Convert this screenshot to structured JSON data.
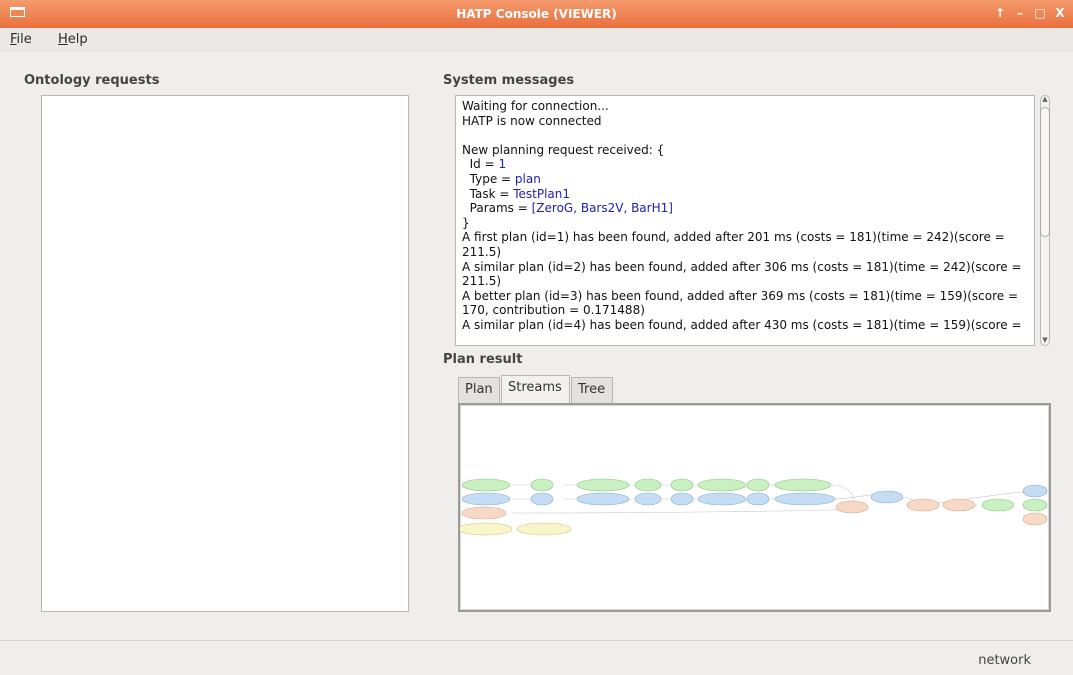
{
  "window": {
    "title": "HATP Console (VIEWER)",
    "controls": [
      "↑",
      "–",
      "□",
      "X"
    ]
  },
  "menu": {
    "file": {
      "mnemonic": "F",
      "rest": "ile"
    },
    "help": {
      "mnemonic": "H",
      "rest": "elp"
    }
  },
  "ontology": {
    "title": "Ontology requests"
  },
  "system_messages": {
    "title": "System messages",
    "lines": [
      "Waiting for connection...",
      "HATP is now connected",
      "",
      "New planning request received: {",
      "  Id = 1",
      "  Type = plan",
      "  Task = TestPlan1",
      "  Params = [ZeroG, Bars2V, BarH1]",
      "}",
      "A first plan (id=1) has been found, added after 201 ms (costs = 181)(time = 242)(score = 211.5)",
      "A similar plan (id=2) has been found, added after 306 ms (costs = 181)(time = 242)(score = 211.5)",
      "A better plan (id=3) has been found, added after 369 ms (costs = 181)(time = 159)(score = 170, contribution = 0.171488)",
      "A similar plan (id=4) has been found, added after 430 ms (costs = 181)(time = 159)(score ="
    ],
    "param_labels": {
      "id": {
        "label": "  Id = ",
        "value": "1"
      },
      "type": {
        "label": "  Type = ",
        "value": "plan"
      },
      "task": {
        "label": "  Task = ",
        "value": "TestPlan1"
      },
      "params": {
        "label": "  Params = ",
        "value": "[ZeroG, Bars2V, BarH1]"
      }
    }
  },
  "plan_result": {
    "title": "Plan result",
    "tabs": [
      "Plan",
      "Streams",
      "Tree"
    ],
    "active_tab": "Streams"
  },
  "colors": {
    "green_node": "#c8f0c0",
    "blue_node": "#c5dcf5",
    "orange_node": "#f8d9c5",
    "yellow_node": "#f8f6c8",
    "title_bar": "#ee7c48"
  },
  "status": {
    "text": "network"
  }
}
